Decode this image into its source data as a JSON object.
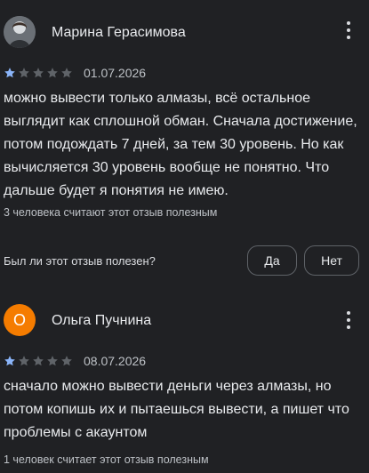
{
  "reviews": [
    {
      "author": "Марина Герасимова",
      "avatar": "user-photo",
      "rating": 1,
      "max_rating": 5,
      "date": "01.07.2026",
      "text": "можно вывести только алмазы, всё остальное выглядит как сплошной обман. Сначала достижение, потом подождать 7 дней, за тем 30 уровень. Но как вычисляется 30 уровень вообще не понятно. Что дальше будет я понятия не имею.",
      "helpful": "3 человека считают этот отзыв полезным",
      "question": "Был ли этот отзыв полезен?",
      "yes_label": "Да",
      "no_label": "Нет"
    },
    {
      "author": "Ольга Пучнина",
      "avatar_letter": "О",
      "rating": 1,
      "max_rating": 5,
      "date": "08.07.2026",
      "text": "сначало можно вывести деньги через алмазы, но потом копишь их и пытаешься вывести, а пишет что проблемы с акаунтом",
      "helpful": "1 человек считает этот отзыв полезным"
    }
  ],
  "colors": {
    "background": "#202124",
    "star_filled": "#8ab4f8",
    "star_empty": "#5f6368",
    "avatar_orange": "#f57c00"
  },
  "icons": [
    "more-vert-icon",
    "star-icon"
  ]
}
